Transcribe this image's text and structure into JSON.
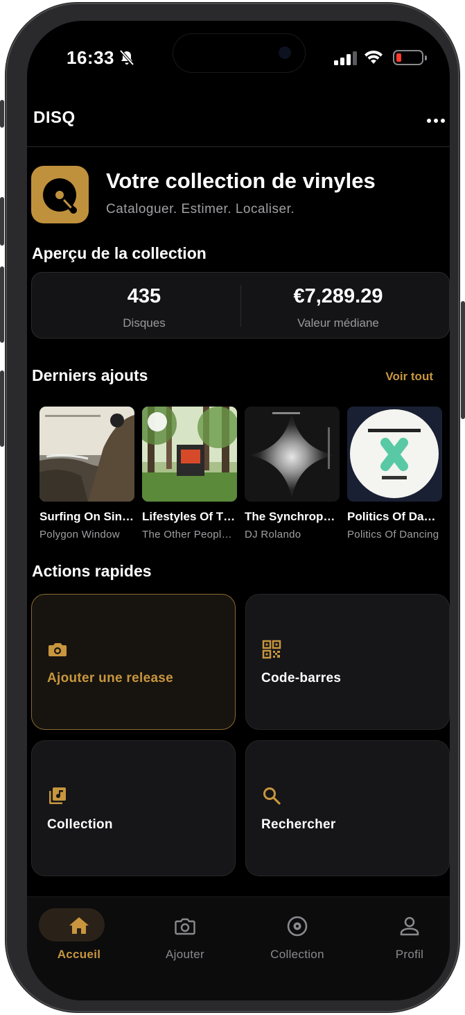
{
  "status_bar": {
    "time": "16:33",
    "accent_low_battery": "#ff3b30"
  },
  "app": {
    "name": "DISQ",
    "accent": "#c8963e"
  },
  "hero": {
    "title": "Votre collection de vinyles",
    "subtitle": "Cataloguer. Estimer. Localiser."
  },
  "overview": {
    "heading": "Aperçu de la collection",
    "records_value": "435",
    "records_label": "Disques",
    "value_value": "€7,289.29",
    "value_label": "Valeur médiane"
  },
  "recent": {
    "heading": "Derniers ajouts",
    "see_all": "Voir tout",
    "items": [
      {
        "title": "Surfing On Sine Waves",
        "artist": "Polygon Window"
      },
      {
        "title": "Lifestyles Of The Laptop Café",
        "artist": "The Other People Place"
      },
      {
        "title": "The Synchrophone",
        "artist": "DJ Rolando"
      },
      {
        "title": "Politics Of Dancing",
        "artist": "Politics Of Dancing"
      }
    ]
  },
  "quick_actions": {
    "heading": "Actions rapides",
    "items": [
      {
        "label": "Ajouter une release",
        "icon": "camera-icon"
      },
      {
        "label": "Code-barres",
        "icon": "qr-code-icon"
      },
      {
        "label": "Collection",
        "icon": "music-library-icon"
      },
      {
        "label": "Rechercher",
        "icon": "search-icon"
      }
    ]
  },
  "tabs": [
    {
      "label": "Accueil",
      "icon": "home-icon",
      "active": true
    },
    {
      "label": "Ajouter",
      "icon": "camera-icon"
    },
    {
      "label": "Collection",
      "icon": "vinyl-icon"
    },
    {
      "label": "Profil",
      "icon": "person-icon"
    }
  ]
}
